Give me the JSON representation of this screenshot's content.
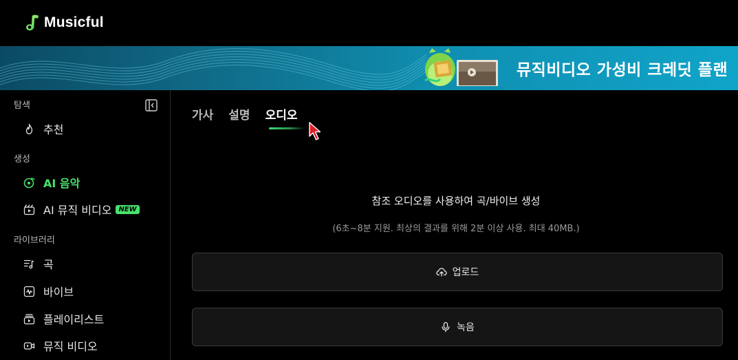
{
  "app": {
    "name": "Musicful",
    "brand_color": "#47e06a"
  },
  "banner": {
    "text": "뮤직비디오 가성비 크레딧 플랜"
  },
  "sidebar": {
    "sections": [
      {
        "label": "탐색"
      },
      {
        "label": "생성"
      },
      {
        "label": "라이브러리"
      }
    ],
    "items": [
      {
        "label": "추천",
        "icon": "flame-icon"
      },
      {
        "label": "AI 음악",
        "icon": "vinyl-music-icon",
        "active": true
      },
      {
        "label": "AI 뮤직 비디오",
        "icon": "clapperboard-icon",
        "badge": "NEW"
      },
      {
        "label": "곡",
        "icon": "song-list-icon"
      },
      {
        "label": "바이브",
        "icon": "waveform-icon"
      },
      {
        "label": "플레이리스트",
        "icon": "playlist-icon"
      },
      {
        "label": "뮤직 비디오",
        "icon": "video-camera-icon"
      }
    ]
  },
  "main": {
    "tabs": [
      {
        "label": "가사"
      },
      {
        "label": "설명"
      },
      {
        "label": "오디오",
        "active": true
      }
    ],
    "heading": "참조 오디오를 사용하여 곡/바이브 생성",
    "subtext": "(6초~8분 지원. 최상의 결과를 위해 2분 이상 사용. 최대 40MB.)",
    "upload_label": "업로드",
    "record_label": "녹음"
  }
}
